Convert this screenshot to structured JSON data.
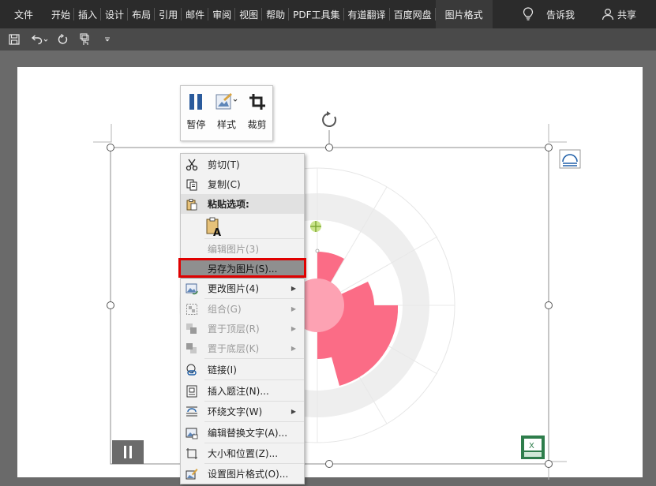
{
  "ribbon": {
    "tabs": [
      "文件",
      "开始",
      "插入",
      "设计",
      "布局",
      "引用",
      "邮件",
      "审阅",
      "视图",
      "帮助",
      "PDF工具集",
      "有道翻译",
      "百度网盘",
      "图片格式"
    ],
    "tell_me": "告诉我",
    "share": "共享"
  },
  "mini_toolbar": {
    "pause": "暂停",
    "style": "样式",
    "crop": "裁剪"
  },
  "context_menu": {
    "cut": "剪切(T)",
    "copy": "复制(C)",
    "paste_options": "粘贴选项:",
    "edit_picture": "编辑图片(3)",
    "save_as_picture": "另存为图片(S)...",
    "change_picture": "更改图片(4)",
    "group": "组合(G)",
    "bring_to_front": "置于顶层(R)",
    "send_to_back": "置于底层(K)",
    "link": "链接(I)",
    "insert_caption": "插入题注(N)...",
    "wrap_text": "环绕文字(W)",
    "edit_alt_text": "编辑替换文字(A)...",
    "size_position": "大小和位置(Z)...",
    "format_picture": "设置图片格式(O)..."
  },
  "colors": {
    "accent_pink": "#fb6c86",
    "light_pink": "#fda2b3",
    "ring_gray": "#eeeeee",
    "highlight_red": "#e00000",
    "dark_bar": "#2b2b2b"
  }
}
